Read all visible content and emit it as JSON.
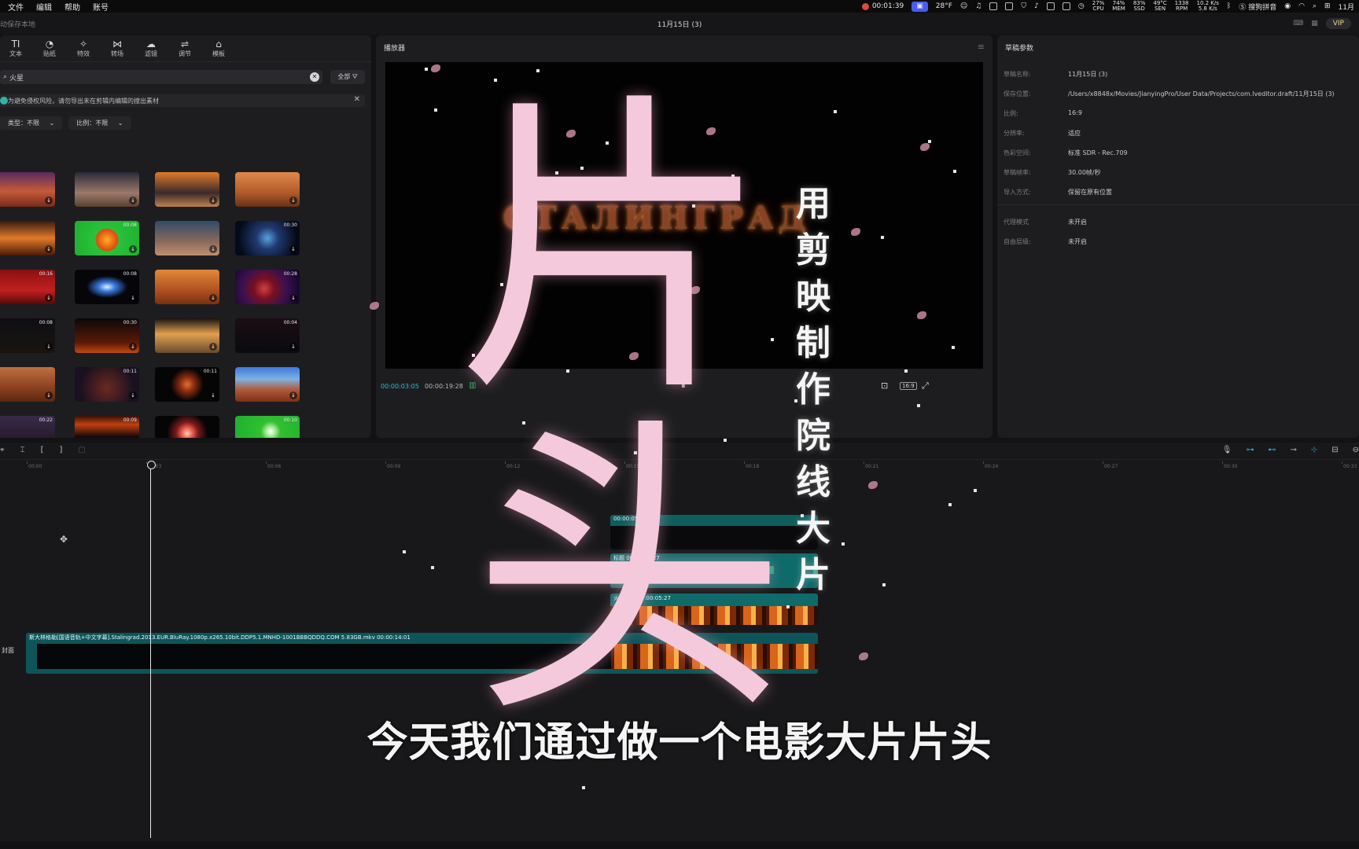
{
  "menubar": {
    "menus": [
      "文件",
      "编辑",
      "帮助",
      "账号"
    ],
    "record_time": "00:01:39",
    "temp": "28°F",
    "stats": [
      {
        "value": "27%",
        "label": "CPU"
      },
      {
        "value": "74%",
        "label": "MEM"
      },
      {
        "value": "83%",
        "label": "SSD"
      },
      {
        "value": "49°C",
        "label": "SEN"
      },
      {
        "value": "1338",
        "label": "RPM"
      },
      {
        "value": "10.2 K/s",
        "label": "5.8 K/s"
      }
    ],
    "input_method": "搜狗拼音",
    "date": "11月"
  },
  "titlebar": {
    "save_status": "动保存本地",
    "title": "11月15日 (3)",
    "vip": "VIP"
  },
  "tools": [
    {
      "icon": "text-icon",
      "glyph": "TI",
      "label": "文本"
    },
    {
      "icon": "sticker-icon",
      "glyph": "◔",
      "label": "贴纸"
    },
    {
      "icon": "effects-icon",
      "glyph": "✧",
      "label": "特效"
    },
    {
      "icon": "transition-icon",
      "glyph": "⋈",
      "label": "转场"
    },
    {
      "icon": "filter-icon",
      "glyph": "☁",
      "label": "滤镜"
    },
    {
      "icon": "adjust-icon",
      "glyph": "⇌",
      "label": "调节"
    },
    {
      "icon": "template-icon",
      "glyph": "⌂",
      "label": "模板"
    }
  ],
  "search": {
    "value": "火星",
    "filter_label": "全部"
  },
  "notice": {
    "text": "为避免侵权风险，请勿导出未在剪辑内编辑的搜出素材"
  },
  "filters": {
    "type": "类型：不限",
    "ratio": "比例：不限"
  },
  "thumbnails": [
    {
      "row": 0,
      "col": 0,
      "duration": "",
      "bg": "linear-gradient(180deg,#5a2a5e 0%,#c45a3a 55%,#7a2a1a 100%)"
    },
    {
      "row": 0,
      "col": 1,
      "duration": "",
      "bg": "linear-gradient(180deg,#2a2a3a 0%,#9a7a6a 60%,#5a4030 100%)"
    },
    {
      "row": 0,
      "col": 2,
      "duration": "",
      "bg": "linear-gradient(180deg,#e07a2a 0%,#3a2a2a 60%,#c08050 100%)"
    },
    {
      "row": 0,
      "col": 3,
      "duration": "",
      "bg": "linear-gradient(180deg,#e0884a 0%,#b05a2a 60%,#6a3018 100%)"
    },
    {
      "row": 1,
      "col": 0,
      "duration": "",
      "bg": "linear-gradient(180deg,#3a1a10 0%,#e07a2a 50%,#4a1a08 100%)"
    },
    {
      "row": 1,
      "col": 1,
      "duration": "00:08",
      "bg": "radial-gradient(circle at 50% 55%,#ffb020 0,#e04a10 28%,#2ac23a 32%,#1fae2f 100%)"
    },
    {
      "row": 1,
      "col": 2,
      "duration": "",
      "bg": "linear-gradient(180deg,#304a6a 0%,#8a6a5a 60%,#c09070 100%)"
    },
    {
      "row": 1,
      "col": 3,
      "duration": "00:30",
      "bg": "radial-gradient(circle at 50% 50%,#5aa0e0 0,#203a70 30%,#050a18 80%)"
    },
    {
      "row": 2,
      "col": 0,
      "duration": "00:16",
      "bg": "linear-gradient(180deg,#8a1010 0%,#c02020 60%,#5a0808 100%)"
    },
    {
      "row": 2,
      "col": 1,
      "duration": "00:08",
      "bg": "radial-gradient(ellipse at 50% 50%,#e0f0ff 0,#3a7ae0 18%,#05050a 45%)"
    },
    {
      "row": 2,
      "col": 2,
      "duration": "",
      "bg": "linear-gradient(180deg,#e08a3a 0%,#b05020 60%,#7a3010 100%)"
    },
    {
      "row": 2,
      "col": 3,
      "duration": "00:28",
      "bg": "radial-gradient(circle at 45% 55%,#d04040 0,#7a1020 25%,#3a1050 55%,#0a0520 100%)"
    },
    {
      "row": 3,
      "col": 0,
      "duration": "00:08",
      "bg": "linear-gradient(180deg,#0e0e12 0%,#1a1410 100%)"
    },
    {
      "row": 3,
      "col": 1,
      "duration": "00:30",
      "bg": "linear-gradient(180deg,#0a0808 0%,#5a1a08 70%,#c04a10 100%)"
    },
    {
      "row": 3,
      "col": 2,
      "duration": "",
      "bg": "linear-gradient(180deg,#1a1410 0%,#e0a050 45%,#6a4a30 100%)"
    },
    {
      "row": 3,
      "col": 3,
      "duration": "00:04",
      "bg": "linear-gradient(180deg,#1a0e14 0%,#0a0a10 100%)"
    },
    {
      "row": 4,
      "col": 0,
      "duration": "",
      "bg": "linear-gradient(180deg,#c07040 0%,#8a4020 60%,#5a2810 100%)"
    },
    {
      "row": 4,
      "col": 1,
      "duration": "00:11",
      "bg": "radial-gradient(circle at 50% 60%,#6a2a20 0,#1a1020 70%)"
    },
    {
      "row": 4,
      "col": 2,
      "duration": "00:11",
      "bg": "radial-gradient(circle at 50% 50%,#e07030 0,#8a2a10 20%,#050505 45%)"
    },
    {
      "row": 4,
      "col": 3,
      "duration": "",
      "bg": "linear-gradient(180deg,#3a7ae0 0%,#80b0e0 35%,#b05a3a 65%,#7a3018 100%)"
    },
    {
      "row": 5,
      "col": 0,
      "duration": "00:22",
      "bg": "linear-gradient(180deg,#3a2a4a 0%,#1a1420 100%)"
    },
    {
      "row": 5,
      "col": 1,
      "duration": "00:09",
      "bg": "linear-gradient(180deg,#3a1008 0%,#c04010 25%,#1a0808 60%)"
    },
    {
      "row": 5,
      "col": 2,
      "duration": "",
      "bg": "radial-gradient(circle at 50% 50%,#ffe0d0 0,#ff6a5a 12%,#7a1a1a 30%,#050505 55%)"
    },
    {
      "row": 5,
      "col": 3,
      "duration": "00:10",
      "bg": "radial-gradient(circle at 55% 45%,#ffffff 0,#b0f0a0 10%,#30c030 25%,#1fae2f 100%)"
    }
  ],
  "player": {
    "title": "播放器",
    "current_time": "00:00:03:05",
    "total_time": "00:00:19:28",
    "ratio": "16:9",
    "video_text": "СТАЛИНГРАД"
  },
  "properties": {
    "title": "草稿参数",
    "rows": [
      {
        "label": "草稿名称:",
        "value": "11月15日 (3)"
      },
      {
        "label": "保存位置:",
        "value": "/Users/x8848x/Movies/JianyingPro/User Data/Projects/com.lveditor.draft/11月15日 (3)"
      },
      {
        "label": "比例:",
        "value": "16:9"
      },
      {
        "label": "分辨率:",
        "value": "适应"
      },
      {
        "label": "色彩空间:",
        "value": "标准 SDR - Rec.709"
      },
      {
        "label": "草稿帧率:",
        "value": "30.00帧/秒"
      },
      {
        "label": "导入方式:",
        "value": "保留在原有位置"
      },
      {
        "label": "代理模式",
        "value": "未开启"
      },
      {
        "label": "自由层级:",
        "value": "未开启"
      }
    ]
  },
  "timeline": {
    "ruler": [
      "00:00",
      "00:03",
      "00:06",
      "00:09",
      "00:12",
      "00:15",
      "00:18",
      "00:21",
      "00:24",
      "00:27",
      "00:30",
      "00:33"
    ],
    "cover_label": "封面",
    "clips": [
      {
        "label": "00:00:05:27",
        "kind": "dark"
      },
      {
        "label": "标题 00:00:05:27",
        "kind": "text"
      },
      {
        "label": "火焰火焰 00:00:05:27",
        "kind": "fire"
      },
      {
        "label": "斯大林格勒[国语音轨+中文字幕].Stalingrad.2013.EUR.BluRay.1080p.x265.10bit.DDP5.1.MNHD-1001BBBQDDQ.COM 5.83GB.mkv  00:00:14:01",
        "kind": "main"
      }
    ]
  },
  "overlay": {
    "big1": "片",
    "big2": "头",
    "vertical": [
      "用",
      "剪",
      "映",
      "制",
      "作",
      "院",
      "线",
      "大",
      "片"
    ],
    "subtitle": "今天我们通过做一个电影大片片头"
  }
}
